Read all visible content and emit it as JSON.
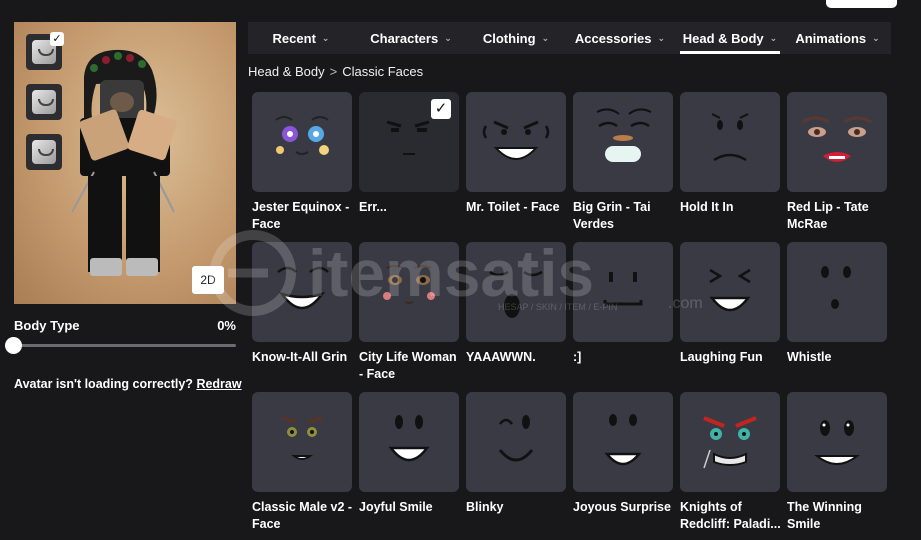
{
  "tabs": [
    {
      "label": "Recent",
      "active": false
    },
    {
      "label": "Characters",
      "active": false
    },
    {
      "label": "Clothing",
      "active": false
    },
    {
      "label": "Accessories",
      "active": false
    },
    {
      "label": "Head & Body",
      "active": true
    },
    {
      "label": "Animations",
      "active": false
    }
  ],
  "breadcrumb": {
    "parent": "Head & Body",
    "separator": ">",
    "current": "Classic Faces"
  },
  "avatar": {
    "toggle_2d": "2D"
  },
  "body_type": {
    "label": "Body Type",
    "value": "0%",
    "level": 0
  },
  "loading_notice": {
    "text": "Avatar isn't loading correctly?",
    "link": "Redraw"
  },
  "watermark": {
    "brand": "itemsatis",
    "tagline": "HESAP / SKIN / ITEM / E-PIN",
    "domain": ".com"
  },
  "items": [
    {
      "name": "Jester Equinox - Face",
      "equipped": false
    },
    {
      "name": "Err...",
      "equipped": true
    },
    {
      "name": "Mr. Toilet - Face",
      "equipped": false
    },
    {
      "name": "Big Grin - Tai Verdes",
      "equipped": false
    },
    {
      "name": "Hold It In",
      "equipped": false
    },
    {
      "name": "Red Lip - Tate McRae",
      "equipped": false
    },
    {
      "name": "Know-It-All Grin",
      "equipped": false
    },
    {
      "name": "City Life Woman - Face",
      "equipped": false
    },
    {
      "name": "YAAAWWN.",
      "equipped": false
    },
    {
      "name": ":]",
      "equipped": false
    },
    {
      "name": "Laughing Fun",
      "equipped": false
    },
    {
      "name": "Whistle",
      "equipped": false
    },
    {
      "name": "Classic Male v2 - Face",
      "equipped": false
    },
    {
      "name": "Joyful Smile",
      "equipped": false
    },
    {
      "name": "Blinky",
      "equipped": false
    },
    {
      "name": "Joyous Surprise",
      "equipped": false
    },
    {
      "name": "Knights of Redcliff: Paladi...",
      "equipped": false
    },
    {
      "name": "The Winning Smile",
      "equipped": false
    }
  ],
  "colors": {
    "background": "#18181b",
    "tile": "#3a3a45",
    "tab_bar": "#232328",
    "accent": "#ffffff"
  }
}
